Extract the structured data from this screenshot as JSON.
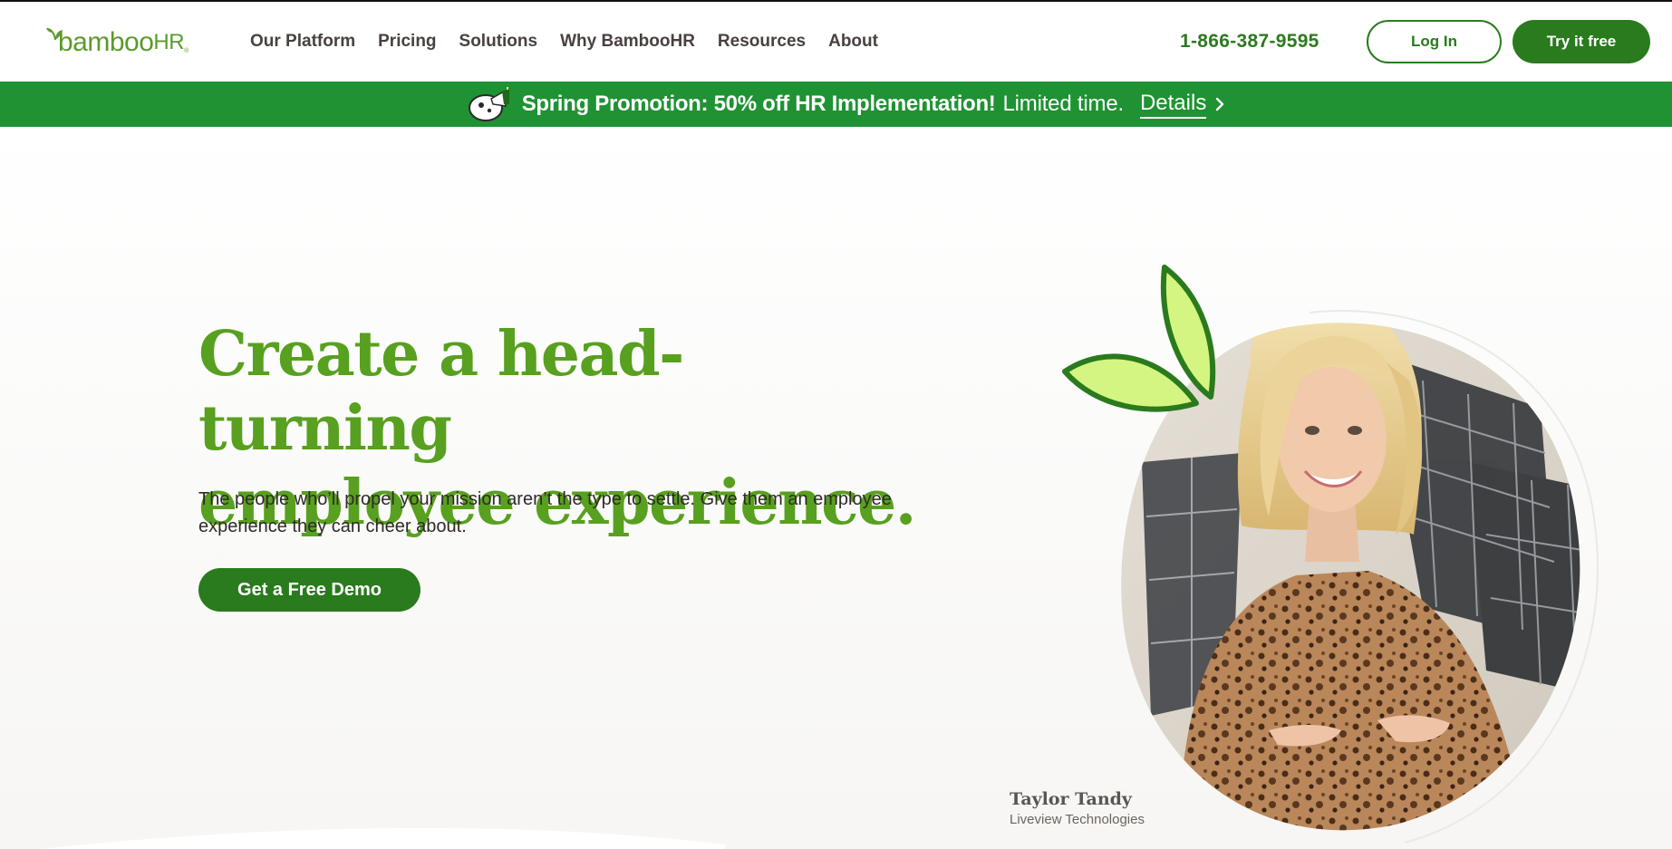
{
  "brand": {
    "logo_main": "bamboo",
    "logo_hr": "HR",
    "logo_reg": "®",
    "colors": {
      "green_dark": "#2a7a1e",
      "green_brand": "#58a01f",
      "promo_green": "#1f9233",
      "leaf_lime": "#d4f582"
    }
  },
  "nav": {
    "items": [
      {
        "label": "Our Platform"
      },
      {
        "label": "Pricing"
      },
      {
        "label": "Solutions"
      },
      {
        "label": "Why BambooHR"
      },
      {
        "label": "Resources"
      },
      {
        "label": "About"
      }
    ],
    "phone": "1-866-387-9595",
    "login_label": "Log In",
    "try_label": "Try it free"
  },
  "promo": {
    "icon": "megaphone-icon",
    "headline": "Spring Promotion: 50% off HR Implementation!",
    "subtext": "Limited time.",
    "link_label": "Details",
    "link_icon": "chevron-right-icon"
  },
  "hero": {
    "title_line1": "Create a head-turning",
    "title_line2": "employee experience.",
    "subtitle": "The people who’ll propel your mission aren’t the type to settle. Give them an employee experience they can cheer about.",
    "cta_label": "Get a Free Demo",
    "testimonial_name": "Taylor Tandy",
    "testimonial_company": "Liveview Technologies"
  }
}
